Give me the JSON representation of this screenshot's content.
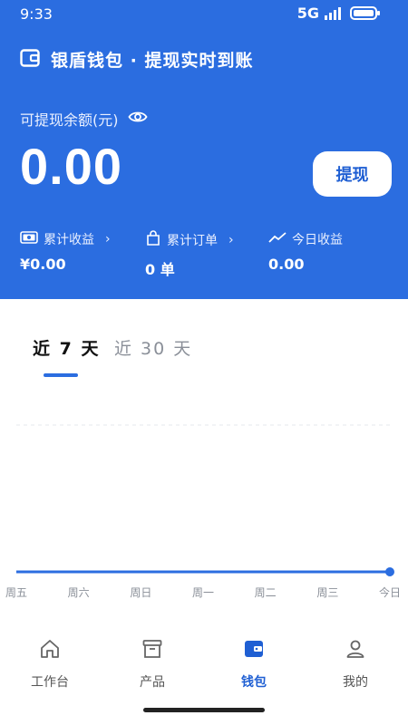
{
  "status_bar": {
    "time": "9:33",
    "network": "5G"
  },
  "header": {
    "app_title": "银盾钱包 · 提现实时到账",
    "balance_label": "可提现余额(元)",
    "balance_amount": "0.00",
    "withdraw_button": "提现",
    "stats": [
      {
        "label": "累计收益",
        "value": "¥0.00",
        "has_chevron": true
      },
      {
        "label": "累计订单",
        "value": "0 单",
        "has_chevron": true
      },
      {
        "label": "今日收益",
        "value": "0.00",
        "has_chevron": false
      }
    ],
    "chevron": "›"
  },
  "tabs": [
    {
      "label": "近 7 天",
      "active": true
    },
    {
      "label": "近 30 天",
      "active": false
    }
  ],
  "chart_data": {
    "type": "line",
    "x": [
      "周五",
      "周六",
      "周日",
      "周一",
      "周二",
      "周三",
      "今日"
    ],
    "series": [
      {
        "values": [
          0,
          0,
          0,
          0,
          0,
          0,
          0
        ]
      }
    ],
    "color": "#2b6de0"
  },
  "bottom_nav": [
    {
      "label": "工作台",
      "icon": "home-icon",
      "active": false
    },
    {
      "label": "产品",
      "icon": "box-icon",
      "active": false
    },
    {
      "label": "钱包",
      "icon": "wallet-icon",
      "active": true
    },
    {
      "label": "我的",
      "icon": "user-icon",
      "active": false
    }
  ],
  "colors": {
    "primary": "#2b6de0",
    "inactive": "#8a8f98"
  }
}
